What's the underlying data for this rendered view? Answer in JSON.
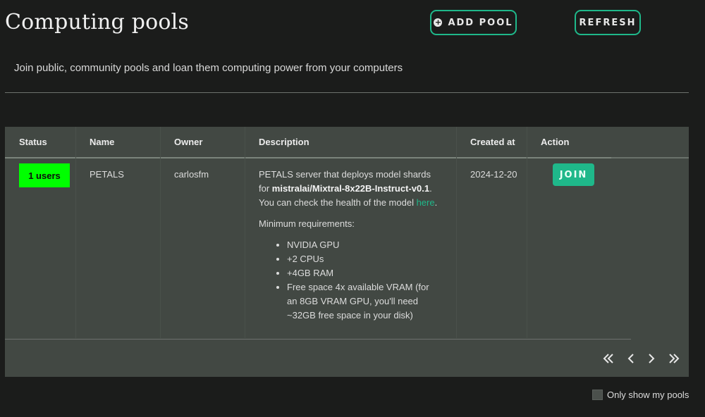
{
  "header": {
    "title": "Computing pools",
    "add_pool_label": "ADD POOL",
    "refresh_label": "REFRESH",
    "subtitle": "Join public, community pools and loan them computing power from your computers"
  },
  "table": {
    "columns": [
      "Status",
      "Name",
      "Owner",
      "Description",
      "Created at",
      "Action"
    ],
    "rows": [
      {
        "status": "1 users",
        "status_color": "#00ff00",
        "name": "PETALS",
        "owner": "carlosfm",
        "desc_intro": "PETALS server that deploys model shards for ",
        "desc_model": "mistralai/Mixtral-8x22B-Instruct-v0.1",
        "desc_health_prefix": ". You can check the health of the model ",
        "desc_link": "here",
        "desc_link_suffix": ".",
        "requirements_title": "Minimum requirements:",
        "requirements": [
          "NVIDIA GPU",
          "+2 CPUs",
          "+4GB RAM",
          "Free space 4x available VRAM (for an 8GB VRAM GPU, you'll need ~32GB free space in your disk)"
        ],
        "created_at": "2024-12-20",
        "action_label": "JOIN"
      }
    ]
  },
  "pagination": {
    "icons": [
      "first-page-icon",
      "prev-page-icon",
      "next-page-icon",
      "last-page-icon"
    ]
  },
  "filters": {
    "only_my_pools_label": "Only show my pools"
  },
  "colors": {
    "accent": "#1fb88a",
    "background": "#1b1c1b",
    "panel": "#424843"
  }
}
